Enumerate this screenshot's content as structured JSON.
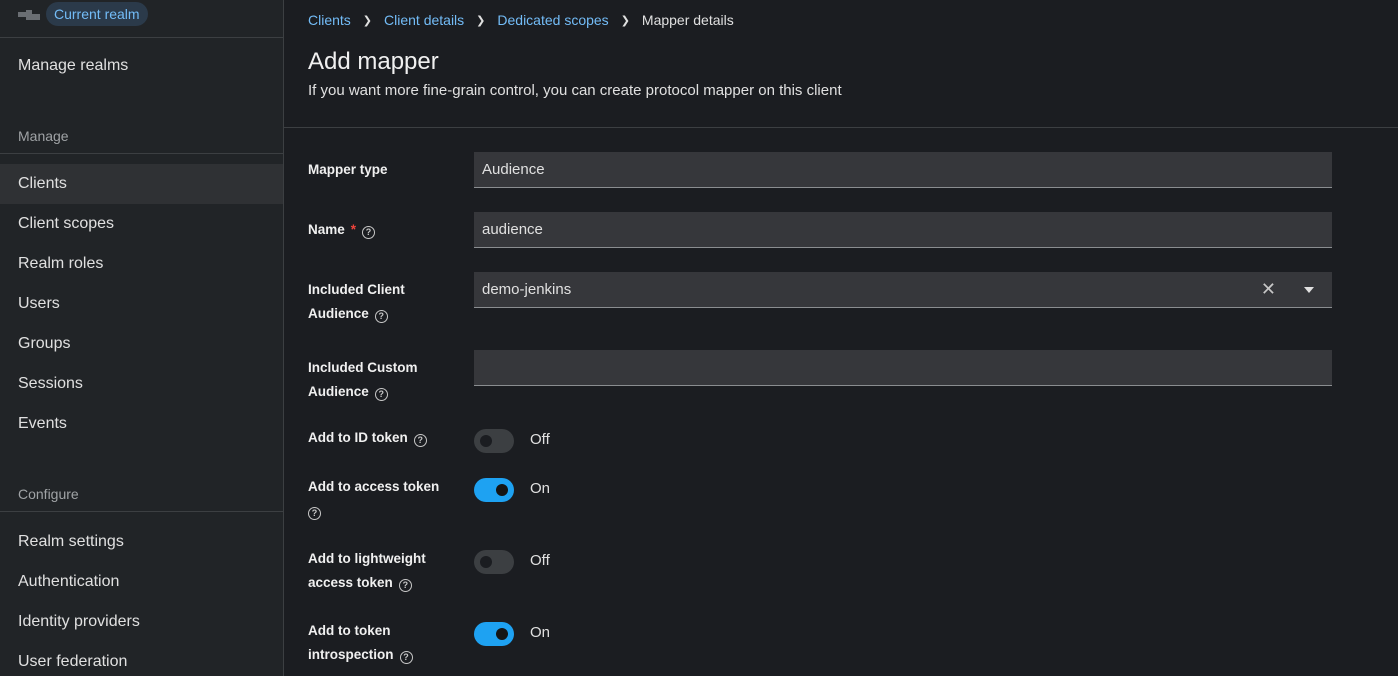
{
  "sidebar": {
    "realm_badge": "Current realm",
    "manage_realms": "Manage realms",
    "manage_section": "Manage",
    "manage_items": [
      "Clients",
      "Client scopes",
      "Realm roles",
      "Users",
      "Groups",
      "Sessions",
      "Events"
    ],
    "configure_section": "Configure",
    "configure_items": [
      "Realm settings",
      "Authentication",
      "Identity providers",
      "User federation"
    ]
  },
  "breadcrumb": {
    "items": [
      "Clients",
      "Client details",
      "Dedicated scopes"
    ],
    "current": "Mapper details"
  },
  "header": {
    "title": "Add mapper",
    "description": "If you want more fine-grain control, you can create protocol mapper on this client"
  },
  "form": {
    "mapper_type": {
      "label": "Mapper type",
      "value": "Audience"
    },
    "name": {
      "label": "Name",
      "required": "*",
      "value": "audience"
    },
    "included_client_audience": {
      "label_line1": "Included Client",
      "label_line2": "Audience",
      "value": "demo-jenkins"
    },
    "included_custom_audience": {
      "label_line1": "Included Custom",
      "label_line2": "Audience",
      "value": ""
    },
    "add_to_id_token": {
      "label": "Add to ID token",
      "state": "Off"
    },
    "add_to_access_token": {
      "label": "Add to access token",
      "state": "On"
    },
    "add_to_lightweight": {
      "label_line1": "Add to lightweight",
      "label_line2": "access token",
      "state": "Off"
    },
    "add_to_introspection": {
      "label_line1": "Add to token",
      "label_line2": "introspection",
      "state": "On"
    }
  },
  "colors": {
    "accent": "#1ea2f2",
    "link": "#73bcf7",
    "required": "#f0443c"
  }
}
